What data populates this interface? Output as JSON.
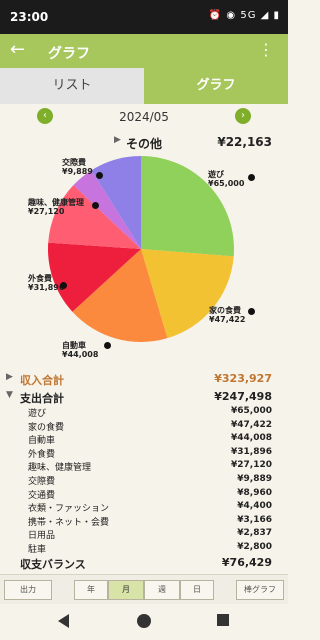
{
  "status": {
    "time": "23:00",
    "icons": "⏰ ◉ 5G ◢ ▮"
  },
  "appbar": {
    "back_icon": "←",
    "title": "グラフ",
    "menu_icon": "⋮"
  },
  "tabs": [
    {
      "label": "リスト"
    },
    {
      "label": "グラフ"
    }
  ],
  "month_nav": {
    "prev": "‹",
    "month": "2024/05",
    "next": "›"
  },
  "other": {
    "label": "その他",
    "value": "¥22,163"
  },
  "chart_data": {
    "type": "pie",
    "slices": [
      {
        "label": "遊び",
        "value": 65000,
        "display": "¥65,000",
        "color": "#8fd15a"
      },
      {
        "label": "家の食費",
        "value": 47422,
        "display": "¥47,422",
        "color": "#f2c233"
      },
      {
        "label": "自動車",
        "value": 44008,
        "display": "¥44,008",
        "color": "#fb8a3f"
      },
      {
        "label": "外食費",
        "value": 31896,
        "display": "¥31,896",
        "color": "#ee1e3d"
      },
      {
        "label": "趣味、健康管理",
        "value": 27120,
        "display": "¥27,120",
        "color": "#ff5d72"
      },
      {
        "label": "交際費",
        "value": 9889,
        "display": "¥9,889",
        "color": "#c774df"
      },
      {
        "label": "その他",
        "value": 22163,
        "display": "¥22,163",
        "color": "#8e80e6"
      }
    ]
  },
  "summary": {
    "income": {
      "label": "収入合計",
      "value": "¥323,927"
    },
    "expense": {
      "label": "支出合計",
      "value": "¥247,498"
    },
    "items": [
      {
        "label": "遊び",
        "value": "¥65,000"
      },
      {
        "label": "家の食費",
        "value": "¥47,422"
      },
      {
        "label": "自動車",
        "value": "¥44,008"
      },
      {
        "label": "外食費",
        "value": "¥31,896"
      },
      {
        "label": "趣味、健康管理",
        "value": "¥27,120"
      },
      {
        "label": "交際費",
        "value": "¥9,889"
      },
      {
        "label": "交通費",
        "value": "¥8,960"
      },
      {
        "label": "衣類・ファッション",
        "value": "¥4,400"
      },
      {
        "label": "携帯・ネット・会費",
        "value": "¥3,166"
      },
      {
        "label": "日用品",
        "value": "¥2,837"
      },
      {
        "label": "駐車",
        "value": "¥2,800"
      }
    ],
    "balance": {
      "label": "収支バランス",
      "value": "¥76,429"
    }
  },
  "toolbar": {
    "output": "出力",
    "year": "年",
    "month": "月",
    "week": "週",
    "day": "日",
    "line_graph": "棒グラフ"
  }
}
